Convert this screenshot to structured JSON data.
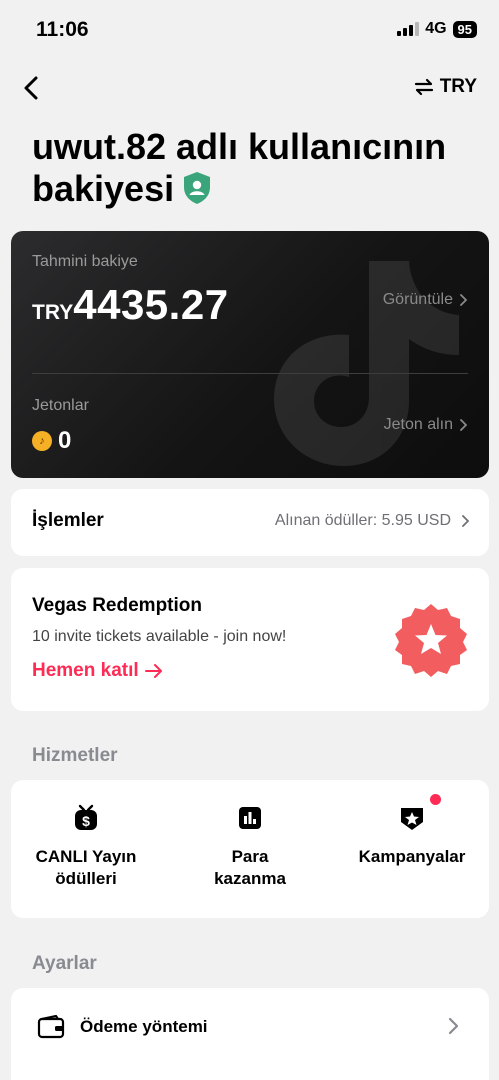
{
  "status_bar": {
    "time": "11:06",
    "network": "4G",
    "battery": "95"
  },
  "nav": {
    "back_icon": "chevron-left-icon",
    "currency_switch_icon": "swap-arrows-icon",
    "currency_label": "TRY"
  },
  "title": {
    "text": "uwut.82 adlı kullanıcının bakiyesi",
    "badge_icon": "verified-shield-icon",
    "badge_color": "#3aa57a"
  },
  "balance_card": {
    "estimated_label": "Tahmini bakiye",
    "currency": "TRY",
    "amount": "4435.27",
    "view_link": "Görüntüle",
    "coins_label": "Jetonlar",
    "coins_value": "0",
    "get_coins_link": "Jeton alın"
  },
  "transactions": {
    "title": "İşlemler",
    "rewards_text": "Alınan ödüller: 5.95 USD"
  },
  "promo": {
    "title": "Vegas Redemption",
    "subtitle": "10 invite tickets available - join now!",
    "cta": "Hemen katıl",
    "accent_color": "#fe2c55",
    "badge_icon": "star-seal-icon",
    "badge_color": "#f25d5f"
  },
  "services": {
    "section_label": "Hizmetler",
    "items": [
      {
        "label_line1": "CANLI Yayın",
        "label_line2": "ödülleri",
        "icon": "live-rewards-icon"
      },
      {
        "label_line1": "Para",
        "label_line2": "kazanma",
        "icon": "monetization-chart-icon"
      },
      {
        "label_line1": "Kampanyalar",
        "label_line2": "",
        "icon": "campaign-star-icon"
      }
    ]
  },
  "settings": {
    "section_label": "Ayarlar",
    "payment_method": "Ödeme yöntemi",
    "payment_icon": "wallet-icon"
  }
}
